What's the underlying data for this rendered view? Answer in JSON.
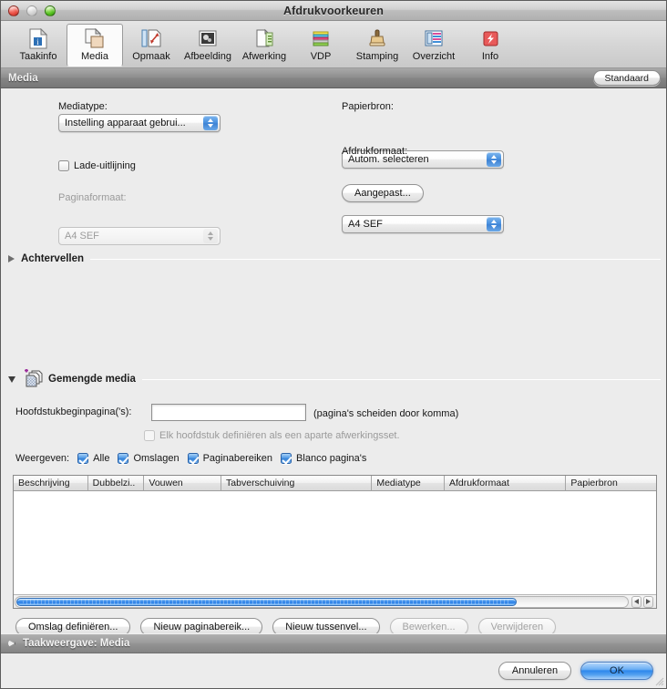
{
  "window": {
    "title": "Afdrukvoorkeuren",
    "controls": {
      "close": "close-button",
      "minimize": "minimize-button",
      "zoom": "zoom-button"
    }
  },
  "toolbar": {
    "items": [
      {
        "label": "Taakinfo",
        "icon": "job-info-icon",
        "selected": false
      },
      {
        "label": "Media",
        "icon": "media-icon",
        "selected": true
      },
      {
        "label": "Opmaak",
        "icon": "layout-icon",
        "selected": false
      },
      {
        "label": "Afbeelding",
        "icon": "image-icon",
        "selected": false
      },
      {
        "label": "Afwerking",
        "icon": "finishing-icon",
        "selected": false
      },
      {
        "label": "VDP",
        "icon": "vdp-icon",
        "selected": false
      },
      {
        "label": "Stamping",
        "icon": "stamp-icon",
        "selected": false
      },
      {
        "label": "Overzicht",
        "icon": "summary-icon",
        "selected": false
      },
      {
        "label": "Info",
        "icon": "info-icon",
        "selected": false
      }
    ]
  },
  "pane": {
    "title": "Media",
    "defaults_button": "Standaard"
  },
  "media": {
    "mediatype_label": "Mediatype:",
    "mediatype_value": "Instelling apparaat gebrui...",
    "tray_alignment_label": "Lade-uitlijning",
    "tray_alignment_checked": false,
    "pageformat_label": "Paginaformaat:",
    "pageformat_value": "A4 SEF",
    "pageformat_disabled": true,
    "papersource_label": "Papierbron:",
    "papersource_value": "Autom. selecteren",
    "printformat_label": "Afdrukformaat:",
    "printformat_value": "A4 SEF",
    "custom_button": "Aangepast..."
  },
  "groups": {
    "backsheets": {
      "label": "Achtervellen",
      "expanded": false,
      "triangle": "disclosure-triangle-right"
    },
    "mixedmedia": {
      "label": "Gemengde media",
      "expanded": true,
      "triangle": "disclosure-triangle-down",
      "icon": "mixed-media-icon"
    },
    "jobview": {
      "label": "Taakweergave: Media",
      "expanded": false,
      "triangle": "disclosure-triangle-right"
    }
  },
  "mixed": {
    "chapter_label": "Hoofdstukbeginpagina('s):",
    "chapter_value": "",
    "chapter_placeholder": "",
    "chapter_hint": "(pagina's scheiden door komma)",
    "finishing_set_label": "Elk hoofdstuk definiëren als een aparte afwerkingsset.",
    "finishing_set_checked": false,
    "finishing_set_disabled": true,
    "show_label": "Weergeven:",
    "show_options": [
      {
        "label": "Alle",
        "checked": true
      },
      {
        "label": "Omslagen",
        "checked": true
      },
      {
        "label": "Paginabereiken",
        "checked": true
      },
      {
        "label": "Blanco pagina's",
        "checked": true
      }
    ]
  },
  "table": {
    "columns": [
      {
        "label": "Beschrijving",
        "width": 82
      },
      {
        "label": "Dubbelzi..",
        "width": 62
      },
      {
        "label": "Vouwen",
        "width": 85
      },
      {
        "label": "Tabverschuiving",
        "width": 166
      },
      {
        "label": "Mediatype",
        "width": 80
      },
      {
        "label": "Afdrukformaat",
        "width": 134
      },
      {
        "label": "Papierbron",
        "width": 99
      }
    ],
    "rows": [],
    "scroll": {
      "thumb_percent": 82,
      "left_arrow": "scroll-left-arrow",
      "right_arrow": "scroll-right-arrow"
    }
  },
  "actions": {
    "buttons": [
      {
        "label": "Omslag definiëren...",
        "disabled": false,
        "name": "define-cover-button"
      },
      {
        "label": "Nieuw paginabereik...",
        "disabled": false,
        "name": "new-page-range-button"
      },
      {
        "label": "Nieuw tussenvel...",
        "disabled": false,
        "name": "new-insert-button"
      },
      {
        "label": "Bewerken...",
        "disabled": true,
        "name": "edit-button"
      },
      {
        "label": "Verwijderen",
        "disabled": true,
        "name": "delete-button"
      }
    ]
  },
  "footer": {
    "cancel_label": "Annuleren",
    "ok_label": "OK"
  },
  "colors": {
    "accent_blue": "#2d87ec",
    "titlebar": "#bdbdbd",
    "pane_header": "#858585",
    "window_bg": "#ececec",
    "purple_plus": "#9b2d9b"
  }
}
